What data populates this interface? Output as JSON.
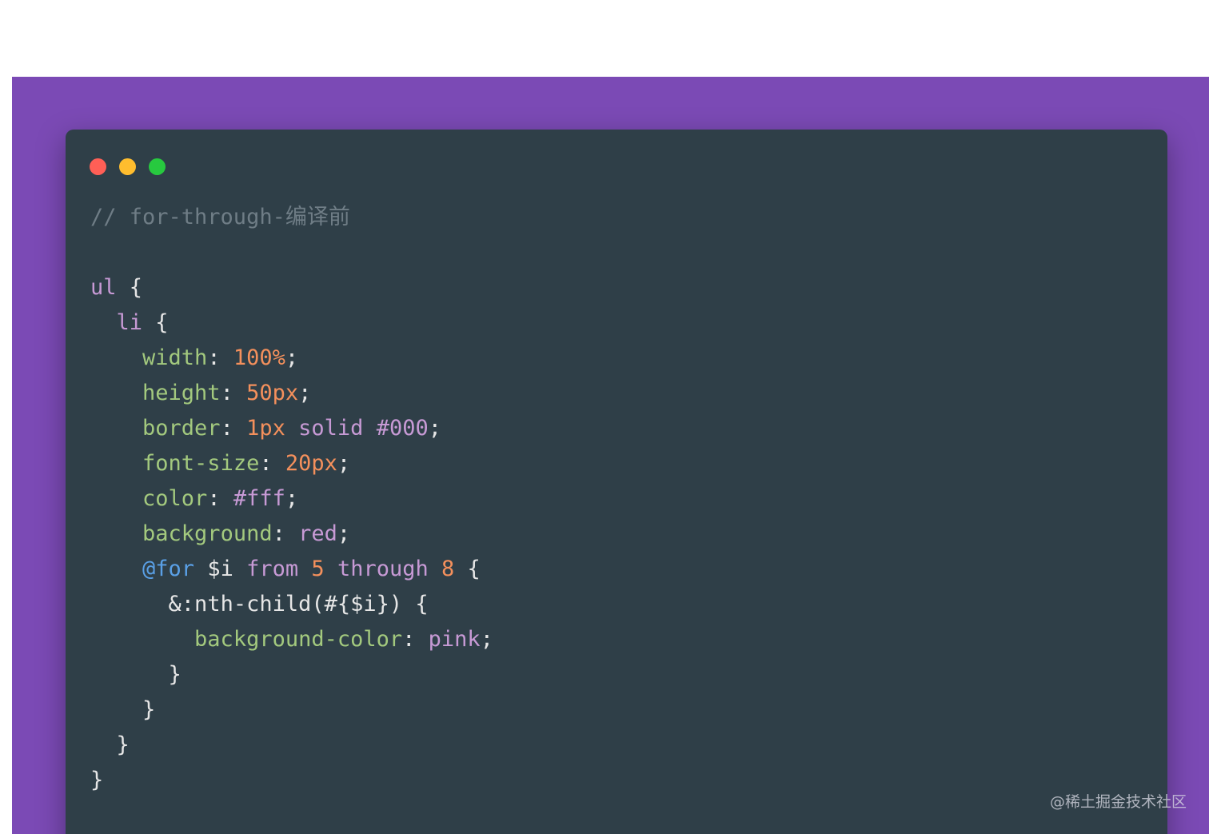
{
  "colors": {
    "page_bg": "#ffffff",
    "stage_bg": "#7b4ab5",
    "window_bg": "#2f3f48",
    "dot_close": "#ff5f56",
    "dot_minimize": "#ffbd2e",
    "dot_maximize": "#27c93f"
  },
  "window": {
    "dots": [
      "close-dot",
      "minimize-dot",
      "maximize-dot"
    ]
  },
  "code": {
    "language": "scss",
    "lines": [
      [
        {
          "t": "comment",
          "v": "// for-through-编译前"
        }
      ],
      [],
      [
        {
          "t": "selector",
          "v": "ul"
        },
        {
          "t": "punc",
          "v": " {"
        }
      ],
      [
        {
          "t": "ws",
          "v": "  "
        },
        {
          "t": "selector",
          "v": "li"
        },
        {
          "t": "punc",
          "v": " {"
        }
      ],
      [
        {
          "t": "ws",
          "v": "    "
        },
        {
          "t": "prop",
          "v": "width"
        },
        {
          "t": "punc",
          "v": ": "
        },
        {
          "t": "num",
          "v": "100%"
        },
        {
          "t": "punc",
          "v": ";"
        }
      ],
      [
        {
          "t": "ws",
          "v": "    "
        },
        {
          "t": "prop",
          "v": "height"
        },
        {
          "t": "punc",
          "v": ": "
        },
        {
          "t": "num",
          "v": "50px"
        },
        {
          "t": "punc",
          "v": ";"
        }
      ],
      [
        {
          "t": "ws",
          "v": "    "
        },
        {
          "t": "prop",
          "v": "border"
        },
        {
          "t": "punc",
          "v": ": "
        },
        {
          "t": "num",
          "v": "1px"
        },
        {
          "t": "punc",
          "v": " "
        },
        {
          "t": "kw",
          "v": "solid"
        },
        {
          "t": "punc",
          "v": " "
        },
        {
          "t": "kw",
          "v": "#000"
        },
        {
          "t": "punc",
          "v": ";"
        }
      ],
      [
        {
          "t": "ws",
          "v": "    "
        },
        {
          "t": "prop",
          "v": "font-size"
        },
        {
          "t": "punc",
          "v": ": "
        },
        {
          "t": "num",
          "v": "20px"
        },
        {
          "t": "punc",
          "v": ";"
        }
      ],
      [
        {
          "t": "ws",
          "v": "    "
        },
        {
          "t": "prop",
          "v": "color"
        },
        {
          "t": "punc",
          "v": ": "
        },
        {
          "t": "kw",
          "v": "#fff"
        },
        {
          "t": "punc",
          "v": ";"
        }
      ],
      [
        {
          "t": "ws",
          "v": "    "
        },
        {
          "t": "prop",
          "v": "background"
        },
        {
          "t": "punc",
          "v": ": "
        },
        {
          "t": "kw",
          "v": "red"
        },
        {
          "t": "punc",
          "v": ";"
        }
      ],
      [
        {
          "t": "ws",
          "v": "    "
        },
        {
          "t": "at",
          "v": "@for"
        },
        {
          "t": "punc",
          "v": " "
        },
        {
          "t": "var",
          "v": "$i"
        },
        {
          "t": "punc",
          "v": " "
        },
        {
          "t": "kw",
          "v": "from"
        },
        {
          "t": "punc",
          "v": " "
        },
        {
          "t": "num",
          "v": "5"
        },
        {
          "t": "punc",
          "v": " "
        },
        {
          "t": "kw",
          "v": "through"
        },
        {
          "t": "punc",
          "v": " "
        },
        {
          "t": "num",
          "v": "8"
        },
        {
          "t": "punc",
          "v": " {"
        }
      ],
      [
        {
          "t": "ws",
          "v": "      "
        },
        {
          "t": "punc",
          "v": "&:nth-child(#{$i}) {"
        }
      ],
      [
        {
          "t": "ws",
          "v": "        "
        },
        {
          "t": "prop",
          "v": "background-color"
        },
        {
          "t": "punc",
          "v": ": "
        },
        {
          "t": "kw",
          "v": "pink"
        },
        {
          "t": "punc",
          "v": ";"
        }
      ],
      [
        {
          "t": "ws",
          "v": "      "
        },
        {
          "t": "punc",
          "v": "}"
        }
      ],
      [
        {
          "t": "ws",
          "v": "    "
        },
        {
          "t": "punc",
          "v": "}"
        }
      ],
      [
        {
          "t": "ws",
          "v": "  "
        },
        {
          "t": "punc",
          "v": "}"
        }
      ],
      [
        {
          "t": "punc",
          "v": "}"
        }
      ]
    ]
  },
  "watermark": {
    "text": "@稀土掘金技术社区"
  }
}
